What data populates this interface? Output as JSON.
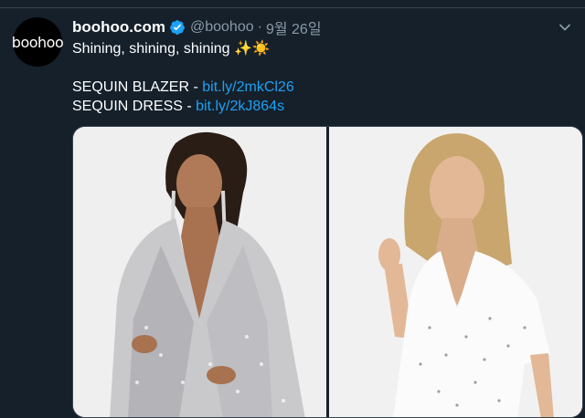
{
  "tweet": {
    "display_name": "boohoo.com",
    "handle": "@boohoo",
    "separator": "·",
    "date": "9월 26일",
    "avatar_text": "boohoo",
    "line1": "Shining, shining, shining ✨☀️",
    "line2_label": "SEQUIN BLAZER - ",
    "line2_link": "bit.ly/2mkCl26",
    "line3_label": "SEQUIN DRESS - ",
    "line3_link": "bit.ly/2kJ864s"
  },
  "media": {
    "photos": [
      {
        "name": "sequin-blazer-photo"
      },
      {
        "name": "sequin-dress-photo"
      }
    ]
  },
  "colors": {
    "background": "#15202b",
    "text": "#ffffff",
    "secondary": "#8899a6",
    "link": "#1da1f2",
    "verified": "#1da1f2"
  },
  "icons": [
    "verified-badge-icon",
    "chevron-down-icon"
  ]
}
